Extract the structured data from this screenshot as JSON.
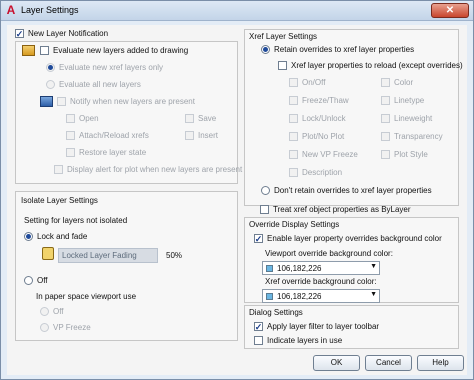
{
  "window": {
    "title": "Layer Settings",
    "app_glyph": "A",
    "close_glyph": "✕"
  },
  "new_layer_notification": {
    "title": "New Layer Notification",
    "evaluate_new_layers": "Evaluate new layers added to drawing",
    "evaluate_xref_only": "Evaluate new xref layers only",
    "evaluate_all": "Evaluate all new layers",
    "notify_when_present": "Notify when new layers are present",
    "opts": {
      "open": "Open",
      "save": "Save",
      "attach_reload": "Attach/Reload xrefs",
      "insert": "Insert",
      "restore_state": "Restore layer state"
    },
    "display_alert": "Display alert for plot when new layers are present"
  },
  "isolate_layer_settings": {
    "title": "Isolate Layer Settings",
    "subtitle": "Setting for layers not isolated",
    "lock_and_fade": "Lock and fade",
    "locked_layer_fading": "Locked Layer Fading",
    "fading_value": "50%",
    "off": "Off",
    "paper_space_label": "In paper space viewport use",
    "ps_off": "Off",
    "ps_vp_freeze": "VP Freeze"
  },
  "xref_layer_settings": {
    "title": "Xref Layer Settings",
    "retain_overrides": "Retain overrides to xref layer properties",
    "reload_props": "Xref layer properties to reload (except overrides)",
    "props_left": [
      "On/Off",
      "Freeze/Thaw",
      "Lock/Unlock",
      "Plot/No Plot",
      "New VP Freeze",
      "Description"
    ],
    "props_right": [
      "Color",
      "Linetype",
      "Lineweight",
      "Transparency",
      "Plot Style"
    ],
    "dont_retain": "Don't retain overrides to xref layer properties",
    "treat_bylayer": "Treat xref object properties as ByLayer"
  },
  "override_display": {
    "title": "Override Display Settings",
    "enable_bg": "Enable layer property overrides background color",
    "viewport_label": "Viewport override background color:",
    "viewport_value": "106,182,226",
    "xref_label": "Xref override background color:",
    "xref_value": "106,182,226"
  },
  "dialog_settings": {
    "title": "Dialog Settings",
    "apply_filter": "Apply layer filter to layer toolbar",
    "indicate_in_use": "Indicate layers in use"
  },
  "buttons": {
    "ok": "OK",
    "cancel": "Cancel",
    "help": "Help"
  }
}
